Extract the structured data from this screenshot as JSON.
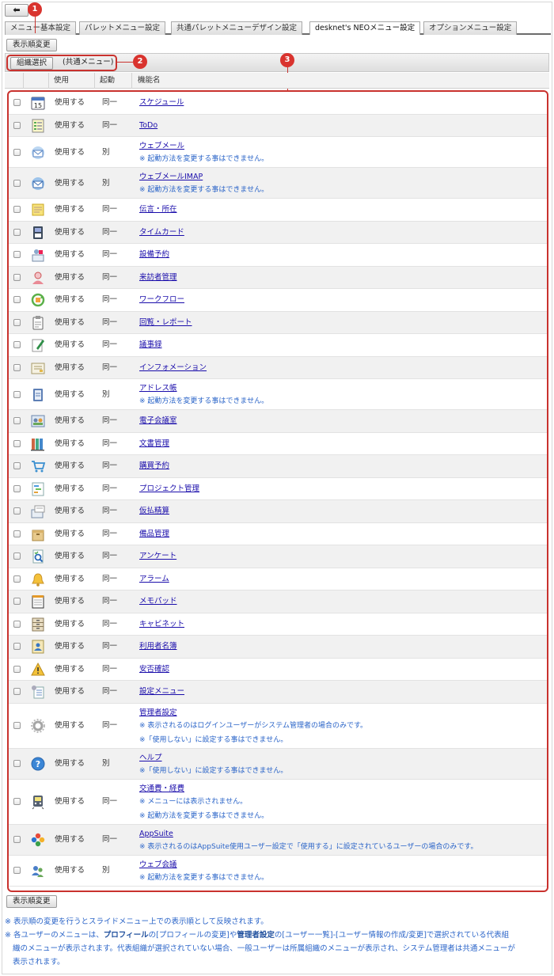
{
  "back_button": "⬅",
  "tabs": [
    {
      "label": "メニュー基本設定",
      "active": false
    },
    {
      "label": "パレットメニュー設定",
      "active": false
    },
    {
      "label": "共通パレットメニューデザイン設定",
      "active": false
    },
    {
      "label": "desknet's NEOメニュー設定",
      "active": true
    },
    {
      "label": "オプションメニュー設定",
      "active": false
    }
  ],
  "order_change_label": "表示順変更",
  "org_select_label": "組織選択",
  "org_current": "(共通メニュー)",
  "markers": [
    "1",
    "2",
    "3"
  ],
  "columns": {
    "use": "使用",
    "launch": "起動",
    "name": "機能名"
  },
  "rows": [
    {
      "icon": "calendar-icon",
      "use": "使用する",
      "launch": "同一",
      "name": "スケジュール",
      "notes": [],
      "alt": false
    },
    {
      "icon": "todo-icon",
      "use": "使用する",
      "launch": "同一",
      "name": "ToDo",
      "notes": [],
      "alt": true
    },
    {
      "icon": "webmail-icon",
      "use": "使用する",
      "launch": "別",
      "name": "ウェブメール",
      "notes": [
        "※ 起動方法を変更する事はできません。"
      ],
      "alt": false
    },
    {
      "icon": "webmail-imap-icon",
      "use": "使用する",
      "launch": "別",
      "name": "ウェブメールIMAP",
      "notes": [
        "※ 起動方法を変更する事はできません。"
      ],
      "alt": true
    },
    {
      "icon": "memo-note-icon",
      "use": "使用する",
      "launch": "同一",
      "name": "伝言・所在",
      "notes": [],
      "alt": false
    },
    {
      "icon": "timecard-icon",
      "use": "使用する",
      "launch": "同一",
      "name": "タイムカード",
      "notes": [],
      "alt": true
    },
    {
      "icon": "facility-icon",
      "use": "使用する",
      "launch": "同一",
      "name": "設備予約",
      "notes": [],
      "alt": false
    },
    {
      "icon": "visitor-icon",
      "use": "使用する",
      "launch": "同一",
      "name": "来訪者管理",
      "notes": [],
      "alt": true
    },
    {
      "icon": "workflow-icon",
      "use": "使用する",
      "launch": "同一",
      "name": "ワークフロー",
      "notes": [],
      "alt": false
    },
    {
      "icon": "clipboard-icon",
      "use": "使用する",
      "launch": "同一",
      "name": "回覧・レポート",
      "notes": [],
      "alt": true
    },
    {
      "icon": "minutes-icon",
      "use": "使用する",
      "launch": "同一",
      "name": "議事録",
      "notes": [],
      "alt": false
    },
    {
      "icon": "information-icon",
      "use": "使用する",
      "launch": "同一",
      "name": "インフォメーション",
      "notes": [],
      "alt": true
    },
    {
      "icon": "address-book-icon",
      "use": "使用する",
      "launch": "別",
      "name": "アドレス帳",
      "notes": [
        "※ 起動方法を変更する事はできません。"
      ],
      "alt": false
    },
    {
      "icon": "conference-icon",
      "use": "使用する",
      "launch": "同一",
      "name": "電子会議室",
      "notes": [],
      "alt": true
    },
    {
      "icon": "documents-icon",
      "use": "使用する",
      "launch": "同一",
      "name": "文書管理",
      "notes": [],
      "alt": false
    },
    {
      "icon": "cart-icon",
      "use": "使用する",
      "launch": "同一",
      "name": "購買予約",
      "notes": [],
      "alt": true
    },
    {
      "icon": "project-icon",
      "use": "使用する",
      "launch": "同一",
      "name": "プロジェクト管理",
      "notes": [],
      "alt": false
    },
    {
      "icon": "expense-icon",
      "use": "使用する",
      "launch": "同一",
      "name": "仮払精算",
      "notes": [],
      "alt": true
    },
    {
      "icon": "box-icon",
      "use": "使用する",
      "launch": "同一",
      "name": "備品管理",
      "notes": [],
      "alt": false
    },
    {
      "icon": "survey-icon",
      "use": "使用する",
      "launch": "同一",
      "name": "アンケート",
      "notes": [],
      "alt": true
    },
    {
      "icon": "bell-icon",
      "use": "使用する",
      "launch": "同一",
      "name": "アラーム",
      "notes": [],
      "alt": false
    },
    {
      "icon": "notepad-icon",
      "use": "使用する",
      "launch": "同一",
      "name": "メモパッド",
      "notes": [],
      "alt": true
    },
    {
      "icon": "cabinet-icon",
      "use": "使用する",
      "launch": "同一",
      "name": "キャビネット",
      "notes": [],
      "alt": false
    },
    {
      "icon": "user-list-icon",
      "use": "使用する",
      "launch": "同一",
      "name": "利用者名簿",
      "notes": [],
      "alt": true
    },
    {
      "icon": "safety-icon",
      "use": "使用する",
      "launch": "同一",
      "name": "安否確認",
      "notes": [],
      "alt": false
    },
    {
      "icon": "settings-menu-icon",
      "use": "使用する",
      "launch": "同一",
      "name": "設定メニュー",
      "notes": [],
      "alt": true
    },
    {
      "icon": "gear-icon",
      "use": "使用する",
      "launch": "同一",
      "name": "管理者設定",
      "notes": [
        "※ 表示されるのはログインユーザーがシステム管理者の場合のみです。",
        "※「使用しない」に設定する事はできません。"
      ],
      "alt": false
    },
    {
      "icon": "help-icon",
      "use": "使用する",
      "launch": "別",
      "name": "ヘルプ",
      "notes": [
        "※「使用しない」に設定する事はできません。"
      ],
      "alt": true
    },
    {
      "icon": "train-icon",
      "use": "使用する",
      "launch": "同一",
      "name": "交通費・経費",
      "notes": [
        "※ メニューには表示されません。",
        "※ 起動方法を変更する事はできません。"
      ],
      "alt": false
    },
    {
      "icon": "appsuite-icon",
      "use": "使用する",
      "launch": "同一",
      "name": "AppSuite",
      "notes": [
        "※ 表示されるのはAppSuite使用ユーザー設定で「使用する」に設定されているユーザーの場合のみです。"
      ],
      "alt": true
    },
    {
      "icon": "web-meeting-icon",
      "use": "使用する",
      "launch": "別",
      "name": "ウェブ会議",
      "notes": [
        "※ 起動方法を変更する事はできません。"
      ],
      "alt": false
    }
  ],
  "footer_note1": "※ 表示順の変更を行うとスライドメニュー上での表示順として反映されます。",
  "footer_note2_parts": {
    "p1": "※ 各ユーザーのメニューは、",
    "b1": "プロフィール",
    "p2": "の[プロフィールの変更]や",
    "b2": "管理者設定",
    "p3": "の[ユーザー一覧]-[ユーザー情報の作成/変更]で選択されている代表組",
    "line2": "織のメニューが表示されます。代表組織が選択されていない場合、一般ユーザーは所属組織のメニューが表示され、システム管理者は共通メニューが",
    "line3": "表示されます。"
  },
  "colors": {
    "accent": "#c9322e",
    "link": "#1a0dab",
    "note": "#2a64c8"
  }
}
